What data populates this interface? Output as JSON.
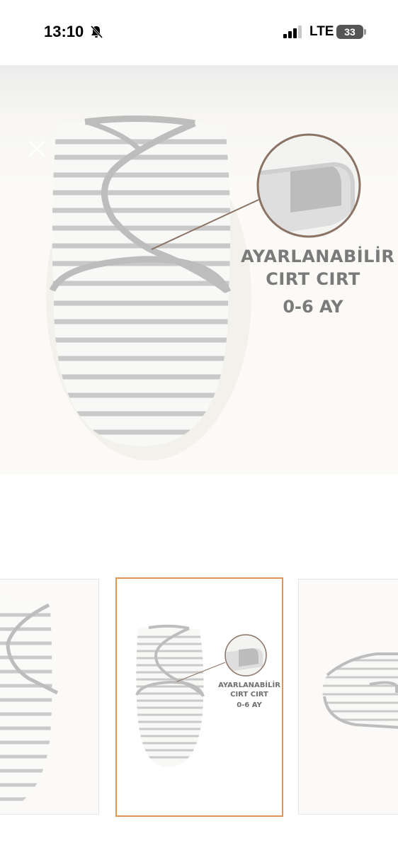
{
  "status_bar": {
    "time": "13:10",
    "network": "LTE",
    "battery": "33",
    "icons": [
      "bell-slash-icon",
      "signal-bars-icon",
      "battery-icon"
    ]
  },
  "hero": {
    "close_icon": "close-icon",
    "callout_line1": "AYARLANABİLİR",
    "callout_line2": "CIRT CIRT",
    "callout_age": "0-6 AY"
  },
  "thumbnails": {
    "selected_index": 1,
    "center": {
      "line1": "AYARLANABİLİR",
      "line2": "CIRT CIRT",
      "line3": "0-6 AY"
    }
  },
  "colors": {
    "selected_border": "#e1954f",
    "stripe": "#c9c9c9",
    "callout_circle": "#8a7364",
    "text_gray": "#7a7a7a"
  }
}
